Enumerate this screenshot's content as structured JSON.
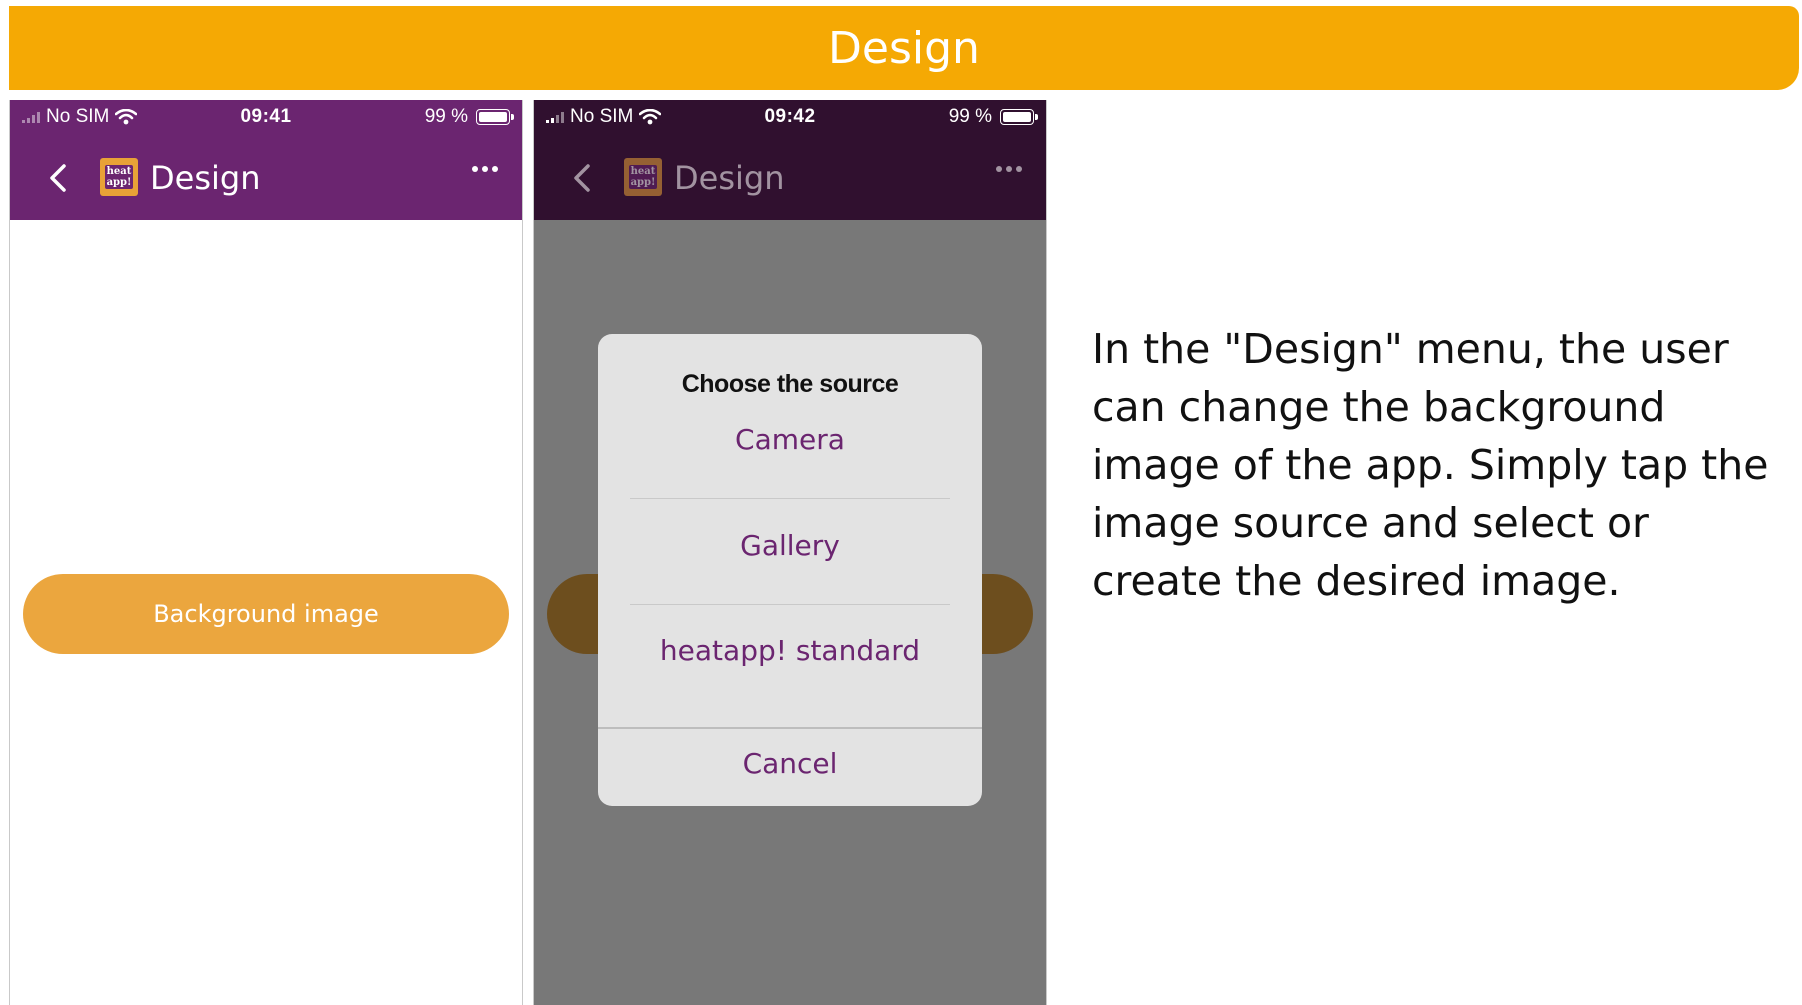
{
  "banner": {
    "title": "Design"
  },
  "phone_left": {
    "status": {
      "carrier": "No SIM",
      "time": "09:41",
      "battery": "99 %"
    },
    "nav": {
      "title": "Design",
      "logo_text": "heat app!"
    },
    "button": {
      "label": "Background image"
    }
  },
  "phone_right": {
    "status": {
      "carrier": "No SIM",
      "time": "09:42",
      "battery": "99 %"
    },
    "nav": {
      "title": "Design",
      "logo_text": "heat app!"
    },
    "dialog": {
      "title": "Choose the source",
      "options": [
        "Camera",
        "Gallery",
        "heatapp! standard"
      ],
      "cancel": "Cancel"
    }
  },
  "description": "In the \"Design\" menu, the user can change the background image of the app. Simply tap the image source and select or create the desired image.",
  "colors": {
    "banner": "#f5a904",
    "appbar": "#6b2570",
    "button": "#eba63e",
    "option_text": "#6b2570"
  },
  "icons": [
    "signal-icon",
    "wifi-icon",
    "battery-icon",
    "back-chevron-icon",
    "heatapp-logo-icon",
    "more-icon"
  ]
}
